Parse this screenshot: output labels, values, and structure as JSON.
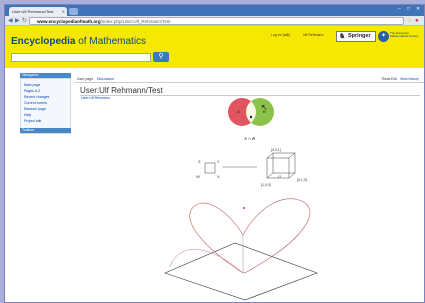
{
  "browser": {
    "tab_title": "User:Ulf Rehmann/Test",
    "url_host": "www.encyclopediaofmath.org",
    "url_path": "/index.php/User:Ulf_Rehmann/Test"
  },
  "header": {
    "logo_bold": "Encyclopedia",
    "logo_rest": " of Mathematics",
    "link_1": "Log in/ (talk)",
    "link_2": "Ulf Rehmann",
    "springer": "Springer",
    "ems_line1": "The European",
    "ems_line2": "Mathematical Society"
  },
  "sidebar": {
    "navigation": "Navigation",
    "items": [
      "Main page",
      "Pages A-Z",
      "Recent changes",
      "Current events",
      "Random page",
      "Help",
      "Project talk"
    ],
    "tools": "Toolbox"
  },
  "page": {
    "tab_left_1": "User page",
    "tab_left_2": "Discussion",
    "tab_right_1": "Read",
    "tab_right_2": "Edit",
    "tab_right_3": "View history",
    "title": "User:Ulf Rehmann/Test",
    "subtitle": "User:Ulf Rehmann"
  },
  "figure": {
    "venn_a": "A",
    "venn_b": "B",
    "venn_caption": "A ∩ B",
    "cube_label_top": "[0,0,1]",
    "cube_label_right": "[0,1,0]",
    "cube_label_left": "[1,0,0]",
    "cube_label_o": "O",
    "square_labels": [
      "Z",
      "Y",
      "W",
      "X"
    ]
  },
  "colors": {
    "header_yellow": "#f6e800",
    "venn_red": "#e0555f",
    "venn_green": "#8bc24a",
    "link_blue": "#0645ad"
  }
}
